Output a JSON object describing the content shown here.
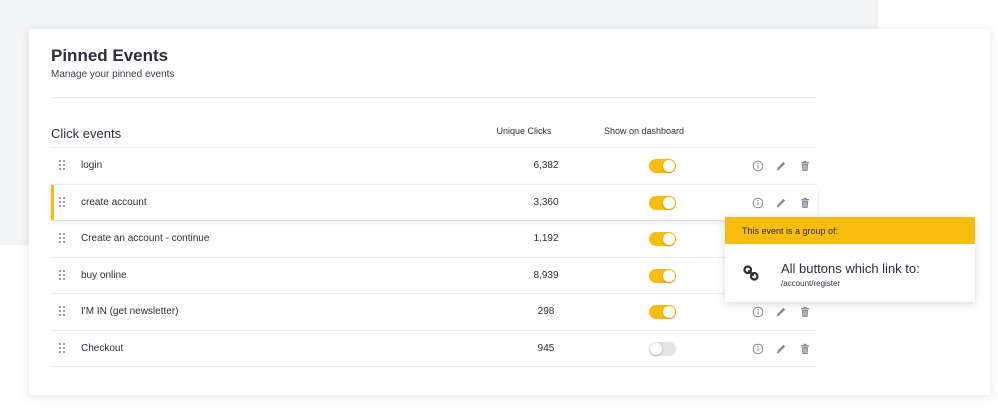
{
  "header": {
    "title": "Pinned Events",
    "subtitle": "Manage your pinned events"
  },
  "table": {
    "section_title": "Click events",
    "columns": {
      "clicks": "Unique Clicks",
      "dashboard": "Show on dashboard"
    },
    "rows": [
      {
        "name": "login",
        "clicks": "6,382",
        "show_on_dashboard": true
      },
      {
        "name": "create account",
        "clicks": "3,360",
        "show_on_dashboard": true,
        "selected": true
      },
      {
        "name": "Create an account - continue",
        "clicks": "1,192",
        "show_on_dashboard": true
      },
      {
        "name": "buy online",
        "clicks": "8,939",
        "show_on_dashboard": true
      },
      {
        "name": "I'M IN (get newsletter)",
        "clicks": "298",
        "show_on_dashboard": true
      },
      {
        "name": "Checkout",
        "clicks": "945",
        "show_on_dashboard": false
      }
    ],
    "row_actions": [
      "info-icon",
      "pencil-icon",
      "trash-icon"
    ]
  },
  "popover": {
    "header": "This event is a group of:",
    "icon": "link-icon",
    "title": "All buttons which link to:",
    "path": "/account/register"
  },
  "colors": {
    "accent": "#f8bd0f",
    "toggle_off": "#e2e3e6",
    "background": "#f3f4f6",
    "text": "#2b2f36"
  }
}
